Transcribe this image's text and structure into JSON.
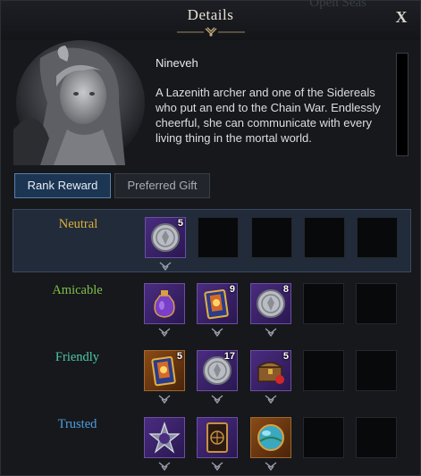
{
  "window": {
    "title": "Details",
    "background_text": "Open Seas",
    "close_label": "X"
  },
  "character": {
    "name": "Nineveh",
    "description": "A Lazenith archer and one of the Sidereals who put an end to the Chain War. Endlessly cheerful, she can communicate with every living thing in the mortal world."
  },
  "tabs": [
    {
      "label": "Rank Reward",
      "active": true
    },
    {
      "label": "Preferred Gift",
      "active": false
    }
  ],
  "tiers": [
    {
      "label": "Neutral",
      "color": "#d9b13a",
      "rewards": [
        {
          "icon": "silver-coin-icon",
          "count": "5"
        }
      ]
    },
    {
      "label": "Amicable",
      "color": "#7fbf4a",
      "rewards": [
        {
          "icon": "potion-flask-icon",
          "count": ""
        },
        {
          "icon": "card-pack-icon",
          "count": "9"
        },
        {
          "icon": "silver-coin-icon",
          "count": "8"
        }
      ]
    },
    {
      "label": "Friendly",
      "color": "#4fc9a6",
      "rewards": [
        {
          "icon": "card-pack-icon",
          "count": "5"
        },
        {
          "icon": "silver-coin-icon",
          "count": "17"
        },
        {
          "icon": "treasure-chest-icon",
          "count": "5"
        }
      ]
    },
    {
      "label": "Trusted",
      "color": "#4f9fe0",
      "rewards": [
        {
          "icon": "star-emblem-icon",
          "count": ""
        },
        {
          "icon": "tarot-card-icon",
          "count": ""
        },
        {
          "icon": "orb-icon",
          "count": ""
        }
      ]
    }
  ]
}
